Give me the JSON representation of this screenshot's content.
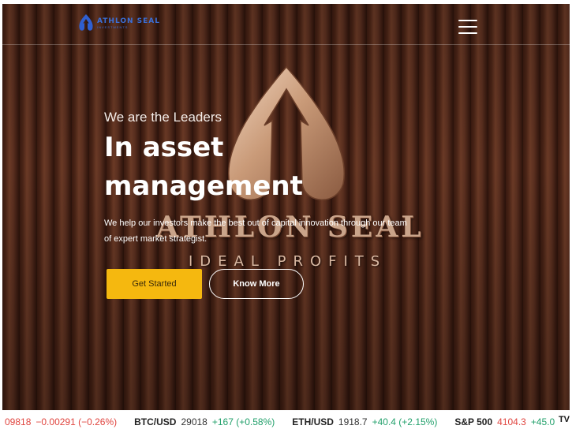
{
  "nav": {
    "logo_text": "ATHLON SEAL",
    "logo_tagline": "INVESTMENTS",
    "menu_icon": "hamburger-menu-icon"
  },
  "hero": {
    "eyebrow": "We are the Leaders",
    "headline_line1": "In asset",
    "headline_line2": "management",
    "subtext": "We help our investors make the best out of capital innovation through our team of expert market strategist.",
    "primary_button": "Get Started",
    "secondary_button": "Know More",
    "wordmark": "ATHLON SEAL",
    "tagline": "IDEAL PROFITS"
  },
  "colors": {
    "accent": "#f5b80f",
    "positive": "#22a06b",
    "negative": "#e0443e"
  },
  "ticker": [
    {
      "symbol": "",
      "price": "09818",
      "change": "−0.00291 (−0.26%)",
      "direction": "down"
    },
    {
      "symbol": "BTC/USD",
      "price": "29018",
      "change": "+167 (+0.58%)",
      "direction": "up"
    },
    {
      "symbol": "ETH/USD",
      "price": "1918.7",
      "change": "+40.4 (+2.15%)",
      "direction": "up"
    },
    {
      "symbol": "S&P 500",
      "price": "4104.3",
      "change": "+45.0",
      "direction": "up"
    }
  ],
  "ticker_badge": "TV"
}
